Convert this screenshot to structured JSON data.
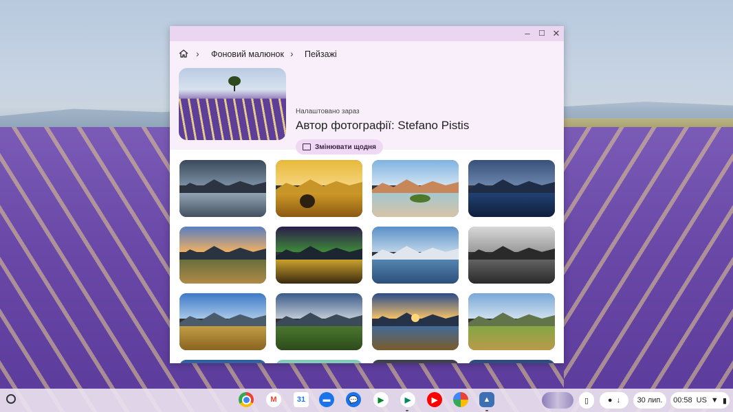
{
  "window": {
    "controls": {
      "minimize": "–",
      "maximize": "☐",
      "close": "✕"
    }
  },
  "breadcrumb": {
    "home_icon": "home-icon",
    "items": [
      "Фоновий малюнок",
      "Пейзажі"
    ]
  },
  "current": {
    "label": "Налаштовано зараз",
    "author": "Автор фотографії: Stefano Pistis",
    "daily_button": "Змінювати щодня"
  },
  "wallpapers": [
    "misty-fjord-reflection",
    "golden-sunset-beach",
    "sandy-coast-mossy-rock",
    "blue-lake-mountains",
    "valley-sunset-road",
    "aurora-night-sky",
    "snowy-peaks-reflection",
    "monochrome-lake",
    "golden-grassland-peaks",
    "green-meadow-dusk",
    "lake-sunrise",
    "green-valley-river",
    "partial-row-1",
    "partial-row-2",
    "partial-row-3",
    "partial-row-4"
  ],
  "shelf": {
    "apps": [
      "Chrome",
      "Gmail",
      "Calendar",
      "Files",
      "Messages",
      "Meet",
      "Play Store",
      "YouTube",
      "Photos",
      "Wallpaper"
    ],
    "date": "30 лип.",
    "time": "00:58",
    "keyboard": "US",
    "status_icons": [
      "wifi-icon",
      "battery-icon"
    ]
  },
  "colors": {
    "title_bar": "#ead6f0",
    "top_section": "#f9effa",
    "button": "#efd8f4"
  }
}
